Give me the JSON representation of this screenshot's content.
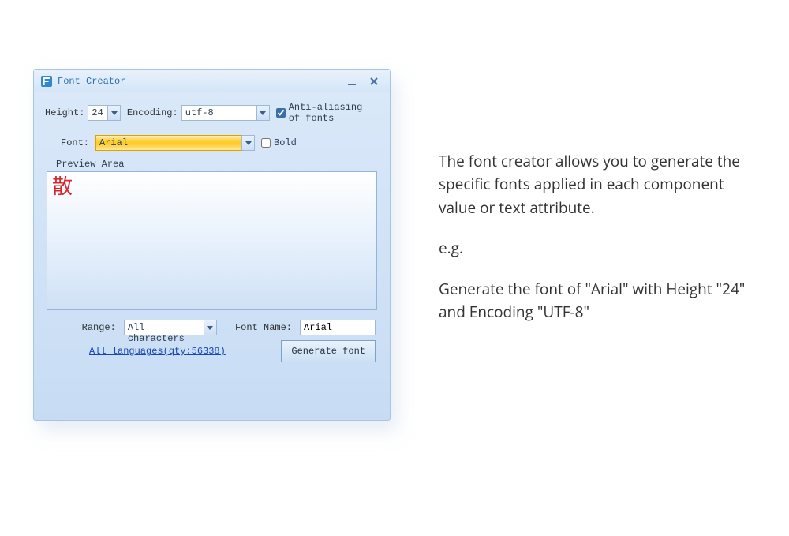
{
  "window": {
    "title": "Font Creator",
    "height_label": "Height:",
    "height_value": "24",
    "encoding_label": "Encoding:",
    "encoding_value": "utf-8",
    "antialias_label": "Anti-aliasing of fonts",
    "antialias_checked": true,
    "font_label": "Font:",
    "font_value": "Arial",
    "bold_label": "Bold",
    "bold_checked": false,
    "preview_label": "Preview Area",
    "preview_glyph": "散",
    "range_label": "Range:",
    "range_value": "All characters",
    "fontname_label": "Font Name:",
    "fontname_value": "Arial",
    "all_languages_link": "All languages(qty:56338)",
    "generate_label": "Generate font"
  },
  "explain": {
    "p1": "The font creator allows you to generate the specific fonts applied in each component value or text attribute.",
    "p2": "e.g.",
    "p3": "Generate the font of \"Arial\" with Height \"24\" and Encoding \"UTF-8\""
  }
}
